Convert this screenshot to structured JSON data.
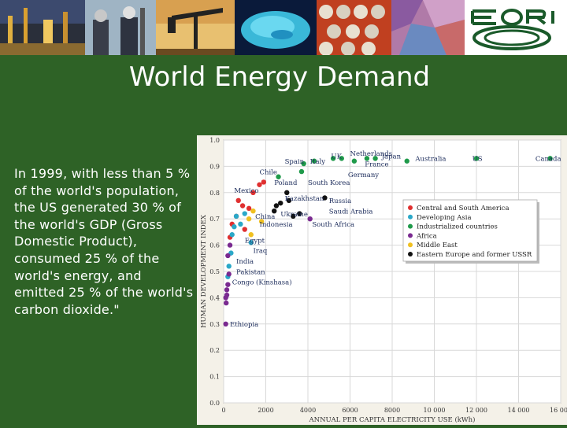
{
  "slide": {
    "title": "World Energy Demand",
    "body_text": "In 1999, with less than 5 % of the world's population, the US generated 30 % of the world's GDP (Gross Domestic Product), consumed 25 % of the world's energy, and emitted 25 % of the world's carbon dioxide.\""
  },
  "banner": {
    "photos": [
      "refinery-photo",
      "workers-photo",
      "pumpjack-photo",
      "geology-model-photo",
      "pipes-photo",
      "minerals-photo"
    ],
    "logo_name": "eori-logo"
  },
  "colors": {
    "background": "#2e6226",
    "Central and South America": "#e03030",
    "Developing Asia": "#2aa8c8",
    "Industrialized countries": "#1f9a4a",
    "Africa": "#7a2a90",
    "Middle East": "#f0c020",
    "Eastern Europe and former USSR": "#111111"
  },
  "chart_data": {
    "type": "scatter",
    "xlabel": "ANNUAL PER CAPITA ELECTRICITY USE (kWh)",
    "ylabel": "HUMAN DEVELOPMENT INDEX",
    "xlim": [
      0,
      16000
    ],
    "ylim": [
      0.0,
      1.0
    ],
    "x_ticks": [
      "0",
      "2000",
      "4000",
      "6000",
      "8000",
      "10 000",
      "12 000",
      "14 000",
      "16 000"
    ],
    "y_ticks": [
      "0.0",
      "0.1",
      "0.2",
      "0.3",
      "0.4",
      "0.5",
      "0.6",
      "0.7",
      "0.8",
      "0.9",
      "1.0"
    ],
    "grid": true,
    "legend_position": "right",
    "series": [
      {
        "name": "Central and South America",
        "points": [
          [
            1900,
            0.84
          ],
          [
            1700,
            0.83
          ],
          [
            1400,
            0.8
          ],
          [
            700,
            0.77
          ],
          [
            900,
            0.75
          ],
          [
            1200,
            0.74
          ],
          [
            600,
            0.71
          ],
          [
            400,
            0.68
          ],
          [
            300,
            0.63
          ],
          [
            1000,
            0.66
          ]
        ]
      },
      {
        "name": "Developing Asia",
        "points": [
          [
            1000,
            0.72
          ],
          [
            800,
            0.68
          ],
          [
            400,
            0.64
          ],
          [
            350,
            0.57
          ],
          [
            250,
            0.52
          ],
          [
            200,
            0.48
          ],
          [
            600,
            0.71
          ],
          [
            500,
            0.67
          ],
          [
            1300,
            0.61
          ]
        ]
      },
      {
        "name": "Industrialized countries",
        "points": [
          [
            3800,
            0.91
          ],
          [
            4300,
            0.92
          ],
          [
            5200,
            0.93
          ],
          [
            5600,
            0.93
          ],
          [
            6800,
            0.93
          ],
          [
            6200,
            0.92
          ],
          [
            7200,
            0.93
          ],
          [
            8700,
            0.92
          ],
          [
            12000,
            0.93
          ],
          [
            15500,
            0.93
          ],
          [
            3700,
            0.88
          ],
          [
            2600,
            0.86
          ]
        ]
      },
      {
        "name": "Africa",
        "points": [
          [
            100,
            0.3
          ],
          [
            120,
            0.38
          ],
          [
            150,
            0.41
          ],
          [
            200,
            0.45
          ],
          [
            250,
            0.49
          ],
          [
            200,
            0.56
          ],
          [
            300,
            0.6
          ],
          [
            4100,
            0.7
          ],
          [
            150,
            0.43
          ],
          [
            100,
            0.4
          ]
        ]
      },
      {
        "name": "Middle East",
        "points": [
          [
            1200,
            0.7
          ],
          [
            1400,
            0.73
          ],
          [
            1300,
            0.64
          ],
          [
            1800,
            0.69
          ]
        ]
      },
      {
        "name": "Eastern Europe and former USSR",
        "points": [
          [
            3100,
            0.77
          ],
          [
            4800,
            0.78
          ],
          [
            2500,
            0.75
          ],
          [
            3300,
            0.71
          ],
          [
            3600,
            0.72
          ],
          [
            2400,
            0.73
          ],
          [
            3000,
            0.8
          ],
          [
            2700,
            0.76
          ]
        ]
      }
    ],
    "annotations": [
      {
        "text": "Netherlands",
        "x": 6000,
        "y": 0.94
      },
      {
        "text": "UK",
        "x": 5100,
        "y": 0.93
      },
      {
        "text": "Japan",
        "x": 7500,
        "y": 0.93
      },
      {
        "text": "Australia",
        "x": 9100,
        "y": 0.92
      },
      {
        "text": "US",
        "x": 11800,
        "y": 0.92
      },
      {
        "text": "Canada",
        "x": 14800,
        "y": 0.92
      },
      {
        "text": "Spain",
        "x": 2900,
        "y": 0.91
      },
      {
        "text": "Italy",
        "x": 4100,
        "y": 0.91
      },
      {
        "text": "France",
        "x": 6700,
        "y": 0.9
      },
      {
        "text": "Germany",
        "x": 5900,
        "y": 0.86
      },
      {
        "text": "Chile",
        "x": 1700,
        "y": 0.87
      },
      {
        "text": "Poland",
        "x": 2400,
        "y": 0.83
      },
      {
        "text": "South Korea",
        "x": 4000,
        "y": 0.83
      },
      {
        "text": "Mexico",
        "x": 500,
        "y": 0.8
      },
      {
        "text": "Kazakhstan",
        "x": 2900,
        "y": 0.77
      },
      {
        "text": "Russia",
        "x": 5000,
        "y": 0.76
      },
      {
        "text": "China",
        "x": 1500,
        "y": 0.7
      },
      {
        "text": "Ukraine",
        "x": 2700,
        "y": 0.71
      },
      {
        "text": "Saudi Arabia",
        "x": 5000,
        "y": 0.72
      },
      {
        "text": "Indonesia",
        "x": 1700,
        "y": 0.67
      },
      {
        "text": "South Africa",
        "x": 4200,
        "y": 0.67
      },
      {
        "text": "Egypt",
        "x": 1000,
        "y": 0.61
      },
      {
        "text": "Iraq",
        "x": 1400,
        "y": 0.57
      },
      {
        "text": "India",
        "x": 600,
        "y": 0.53
      },
      {
        "text": "Pakistan",
        "x": 600,
        "y": 0.49
      },
      {
        "text": "Congo (Kinshasa)",
        "x": 400,
        "y": 0.45
      },
      {
        "text": "Ethiopia",
        "x": 300,
        "y": 0.29
      }
    ]
  }
}
